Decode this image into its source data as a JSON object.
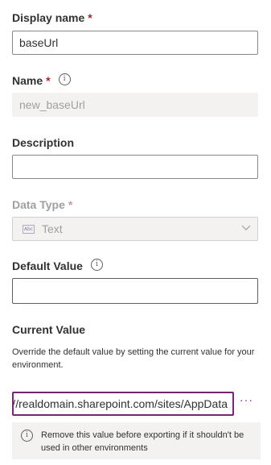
{
  "display_name": {
    "label": "Display name",
    "required_mark": "*",
    "value": "baseUrl"
  },
  "name": {
    "label": "Name",
    "required_mark": "*",
    "value": "new_baseUrl",
    "info_icon": "info-icon"
  },
  "description": {
    "label": "Description",
    "value": ""
  },
  "data_type": {
    "label": "Data Type",
    "required_mark": "*",
    "type_icon": "Abc",
    "value": "Text"
  },
  "default_value": {
    "label": "Default Value",
    "value": "",
    "info_icon": "info-icon"
  },
  "current_value": {
    "label": "Current Value",
    "help": "Override the default value by setting the current value for your environment.",
    "value": "https://realdomain.sharepoint.com/sites/AppData",
    "more_label": "···"
  },
  "warning": {
    "text": "Remove this value before exporting if it shouldn't be used in other environments"
  },
  "colors": {
    "accent": "#742774",
    "required": "#a4262c"
  }
}
